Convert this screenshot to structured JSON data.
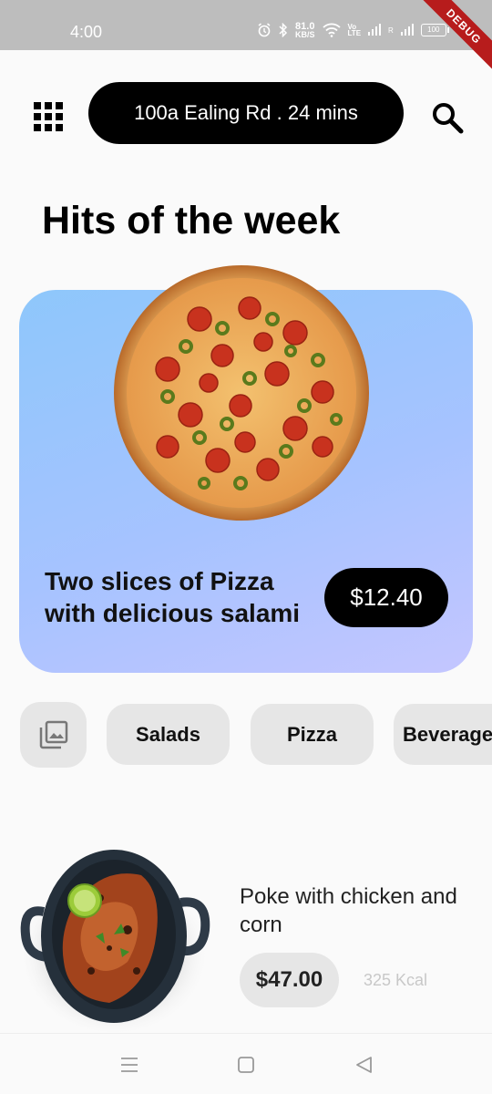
{
  "status_bar": {
    "time": "4:00",
    "net_speed_value": "81.0",
    "net_speed_unit": "KB/S",
    "volte_top": "Vo",
    "volte_bottom": "LTE",
    "roaming": "R",
    "battery": "100",
    "debug_banner": "DEBUG"
  },
  "header": {
    "location": "100a Ealing Rd . 24 mins",
    "menu_icon": "grid-icon",
    "search_icon": "search-icon"
  },
  "section_title": "Hits of the week",
  "hero": {
    "title": "Two slices of Pizza with delicious salami",
    "price": "$12.40",
    "gradient_start": "#8ec7fb",
    "gradient_end": "#c4c6ff"
  },
  "categories": {
    "image_icon": "gallery-icon",
    "items": [
      "Salads",
      "Pizza",
      "Beverage"
    ]
  },
  "product": {
    "name": "Poke with chicken and corn",
    "price": "$47.00",
    "kcal": "325 Kcal"
  },
  "nav": {
    "icons": [
      "menu-icon",
      "home-square-icon",
      "back-triangle-icon"
    ]
  }
}
